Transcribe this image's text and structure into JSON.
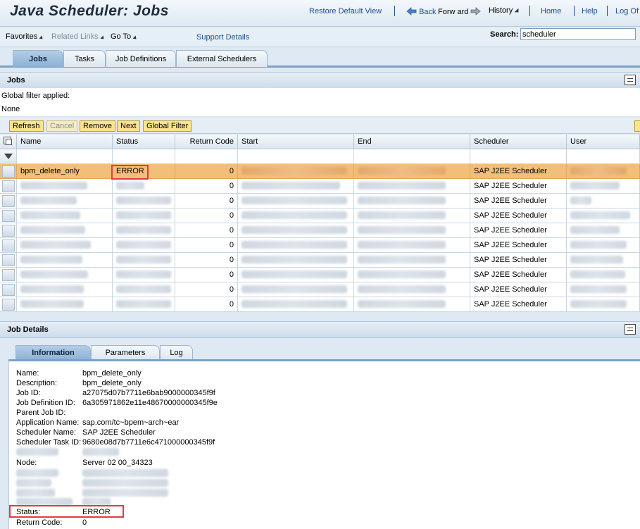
{
  "header": {
    "title": "Java Scheduler: Jobs",
    "restore_default_view": "Restore Default View",
    "back": "Back",
    "forward": "Forw ard",
    "history": "History",
    "home": "Home",
    "help": "Help",
    "log_off": "Log Of"
  },
  "menu": {
    "favorites": "Favorites",
    "related_links": "Related Links",
    "go_to": "Go To",
    "support_details": "Support Details",
    "search_label": "Search:",
    "search_value": "scheduler"
  },
  "tabs": [
    {
      "label": "Jobs",
      "active": true
    },
    {
      "label": "Tasks",
      "active": false
    },
    {
      "label": "Job Definitions",
      "active": false
    },
    {
      "label": "External Schedulers",
      "active": false
    }
  ],
  "jobs_panel": {
    "title": "Jobs",
    "filter_applied_label": "Global filter applied:",
    "filter_value": "None"
  },
  "toolbar": {
    "refresh": "Refresh",
    "cancel": "Cancel",
    "remove": "Remove",
    "next": "Next",
    "global_filter": "Global Filter"
  },
  "table": {
    "columns": [
      "Name",
      "Status",
      "Return Code",
      "Start",
      "End",
      "Scheduler",
      "User"
    ],
    "rows": [
      {
        "name": "bpm_delete_only",
        "status": "ERROR",
        "return_code": "0",
        "scheduler": "SAP J2EE Scheduler",
        "selected": true
      },
      {
        "name": "",
        "status": "",
        "return_code": "0",
        "scheduler": "SAP J2EE Scheduler",
        "selected": false
      },
      {
        "name": "",
        "status": "",
        "return_code": "0",
        "scheduler": "SAP J2EE Scheduler",
        "selected": false
      },
      {
        "name": "",
        "status": "",
        "return_code": "0",
        "scheduler": "SAP J2EE Scheduler",
        "selected": false
      },
      {
        "name": "",
        "status": "",
        "return_code": "0",
        "scheduler": "SAP J2EE Scheduler",
        "selected": false
      },
      {
        "name": "",
        "status": "",
        "return_code": "0",
        "scheduler": "SAP J2EE Scheduler",
        "selected": false
      },
      {
        "name": "",
        "status": "",
        "return_code": "0",
        "scheduler": "SAP J2EE Scheduler",
        "selected": false
      },
      {
        "name": "",
        "status": "",
        "return_code": "0",
        "scheduler": "SAP J2EE Scheduler",
        "selected": false
      },
      {
        "name": "",
        "status": "",
        "return_code": "0",
        "scheduler": "SAP J2EE Scheduler",
        "selected": false
      },
      {
        "name": "",
        "status": "",
        "return_code": "0",
        "scheduler": "SAP J2EE Scheduler",
        "selected": false
      }
    ]
  },
  "details_panel": {
    "title": "Job Details",
    "tabs": [
      "Information",
      "Parameters",
      "Log"
    ],
    "fields": [
      {
        "label": "Name:",
        "value": "bpm_delete_only"
      },
      {
        "label": "Description:",
        "value": "bpm_delete_only"
      },
      {
        "label": "Job ID:",
        "value": "a27075d07b7711e6bab9000000345f9f"
      },
      {
        "label": "Job Definition ID:",
        "value": "6a305971862e11e48670000000345f9e"
      },
      {
        "label": "Parent Job ID:",
        "value": ""
      },
      {
        "label": "Application Name:",
        "value": "sap.com/tc~bpem~arch~ear"
      },
      {
        "label": "Scheduler Name:",
        "value": "SAP J2EE Scheduler"
      },
      {
        "label": "Scheduler Task ID:",
        "value": "9680e08d7b7711e6c471000000345f9f"
      }
    ],
    "node_label": "Node:",
    "node_value": "Server 02 00_34323",
    "status_label": "Status:",
    "status_value": "ERROR",
    "return_code_label": "Return Code:",
    "return_code_value": "0"
  },
  "colors": {
    "selected_row": "#f2bf78",
    "button_yellow": "#fbe48d",
    "highlight_red": "#e23b3b",
    "link_blue": "#1f4c8f"
  }
}
